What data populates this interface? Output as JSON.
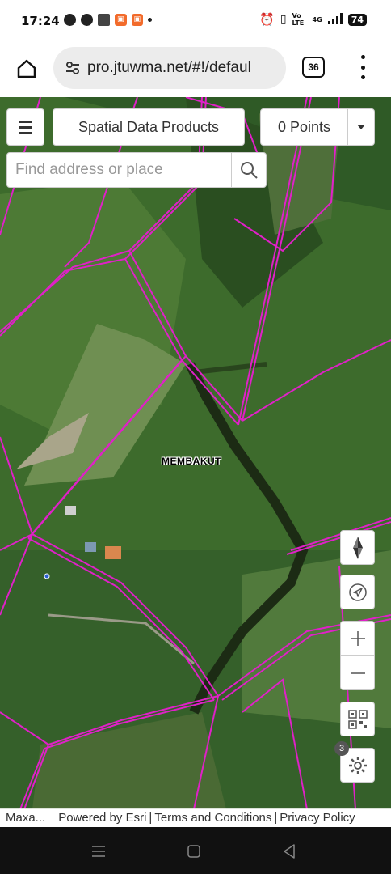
{
  "status_bar": {
    "time": "17:24",
    "battery": "74",
    "network": "4G",
    "volte": "Vo LTE",
    "icons": [
      "chat-icon",
      "messenger-icon",
      "app-badge-icon",
      "alarm-icon",
      "vibrate-icon",
      "signal-icon"
    ]
  },
  "browser": {
    "url": "pro.jtuwma.net/#!/defaul",
    "tab_count": "36"
  },
  "map_toolbar": {
    "menu_icon": "hamburger-icon",
    "spatial_button": "Spatial Data Products",
    "points_button": "0 Points",
    "search_placeholder": "Find address or place"
  },
  "map": {
    "place_label": "MEMBAKUT",
    "parcel_color": "#e020c8",
    "settings_badge": "3"
  },
  "controls": [
    "compass-icon",
    "locate-icon",
    "zoom-in-icon",
    "zoom-out-icon",
    "qr-icon",
    "gear-icon"
  ],
  "attribution": {
    "left": "Maxa...",
    "powered": "Powered by Esri",
    "terms": "Terms and Conditions",
    "privacy": "Privacy Policy",
    "separator": "|"
  },
  "nav": [
    "recents-icon",
    "home-icon",
    "back-icon"
  ]
}
